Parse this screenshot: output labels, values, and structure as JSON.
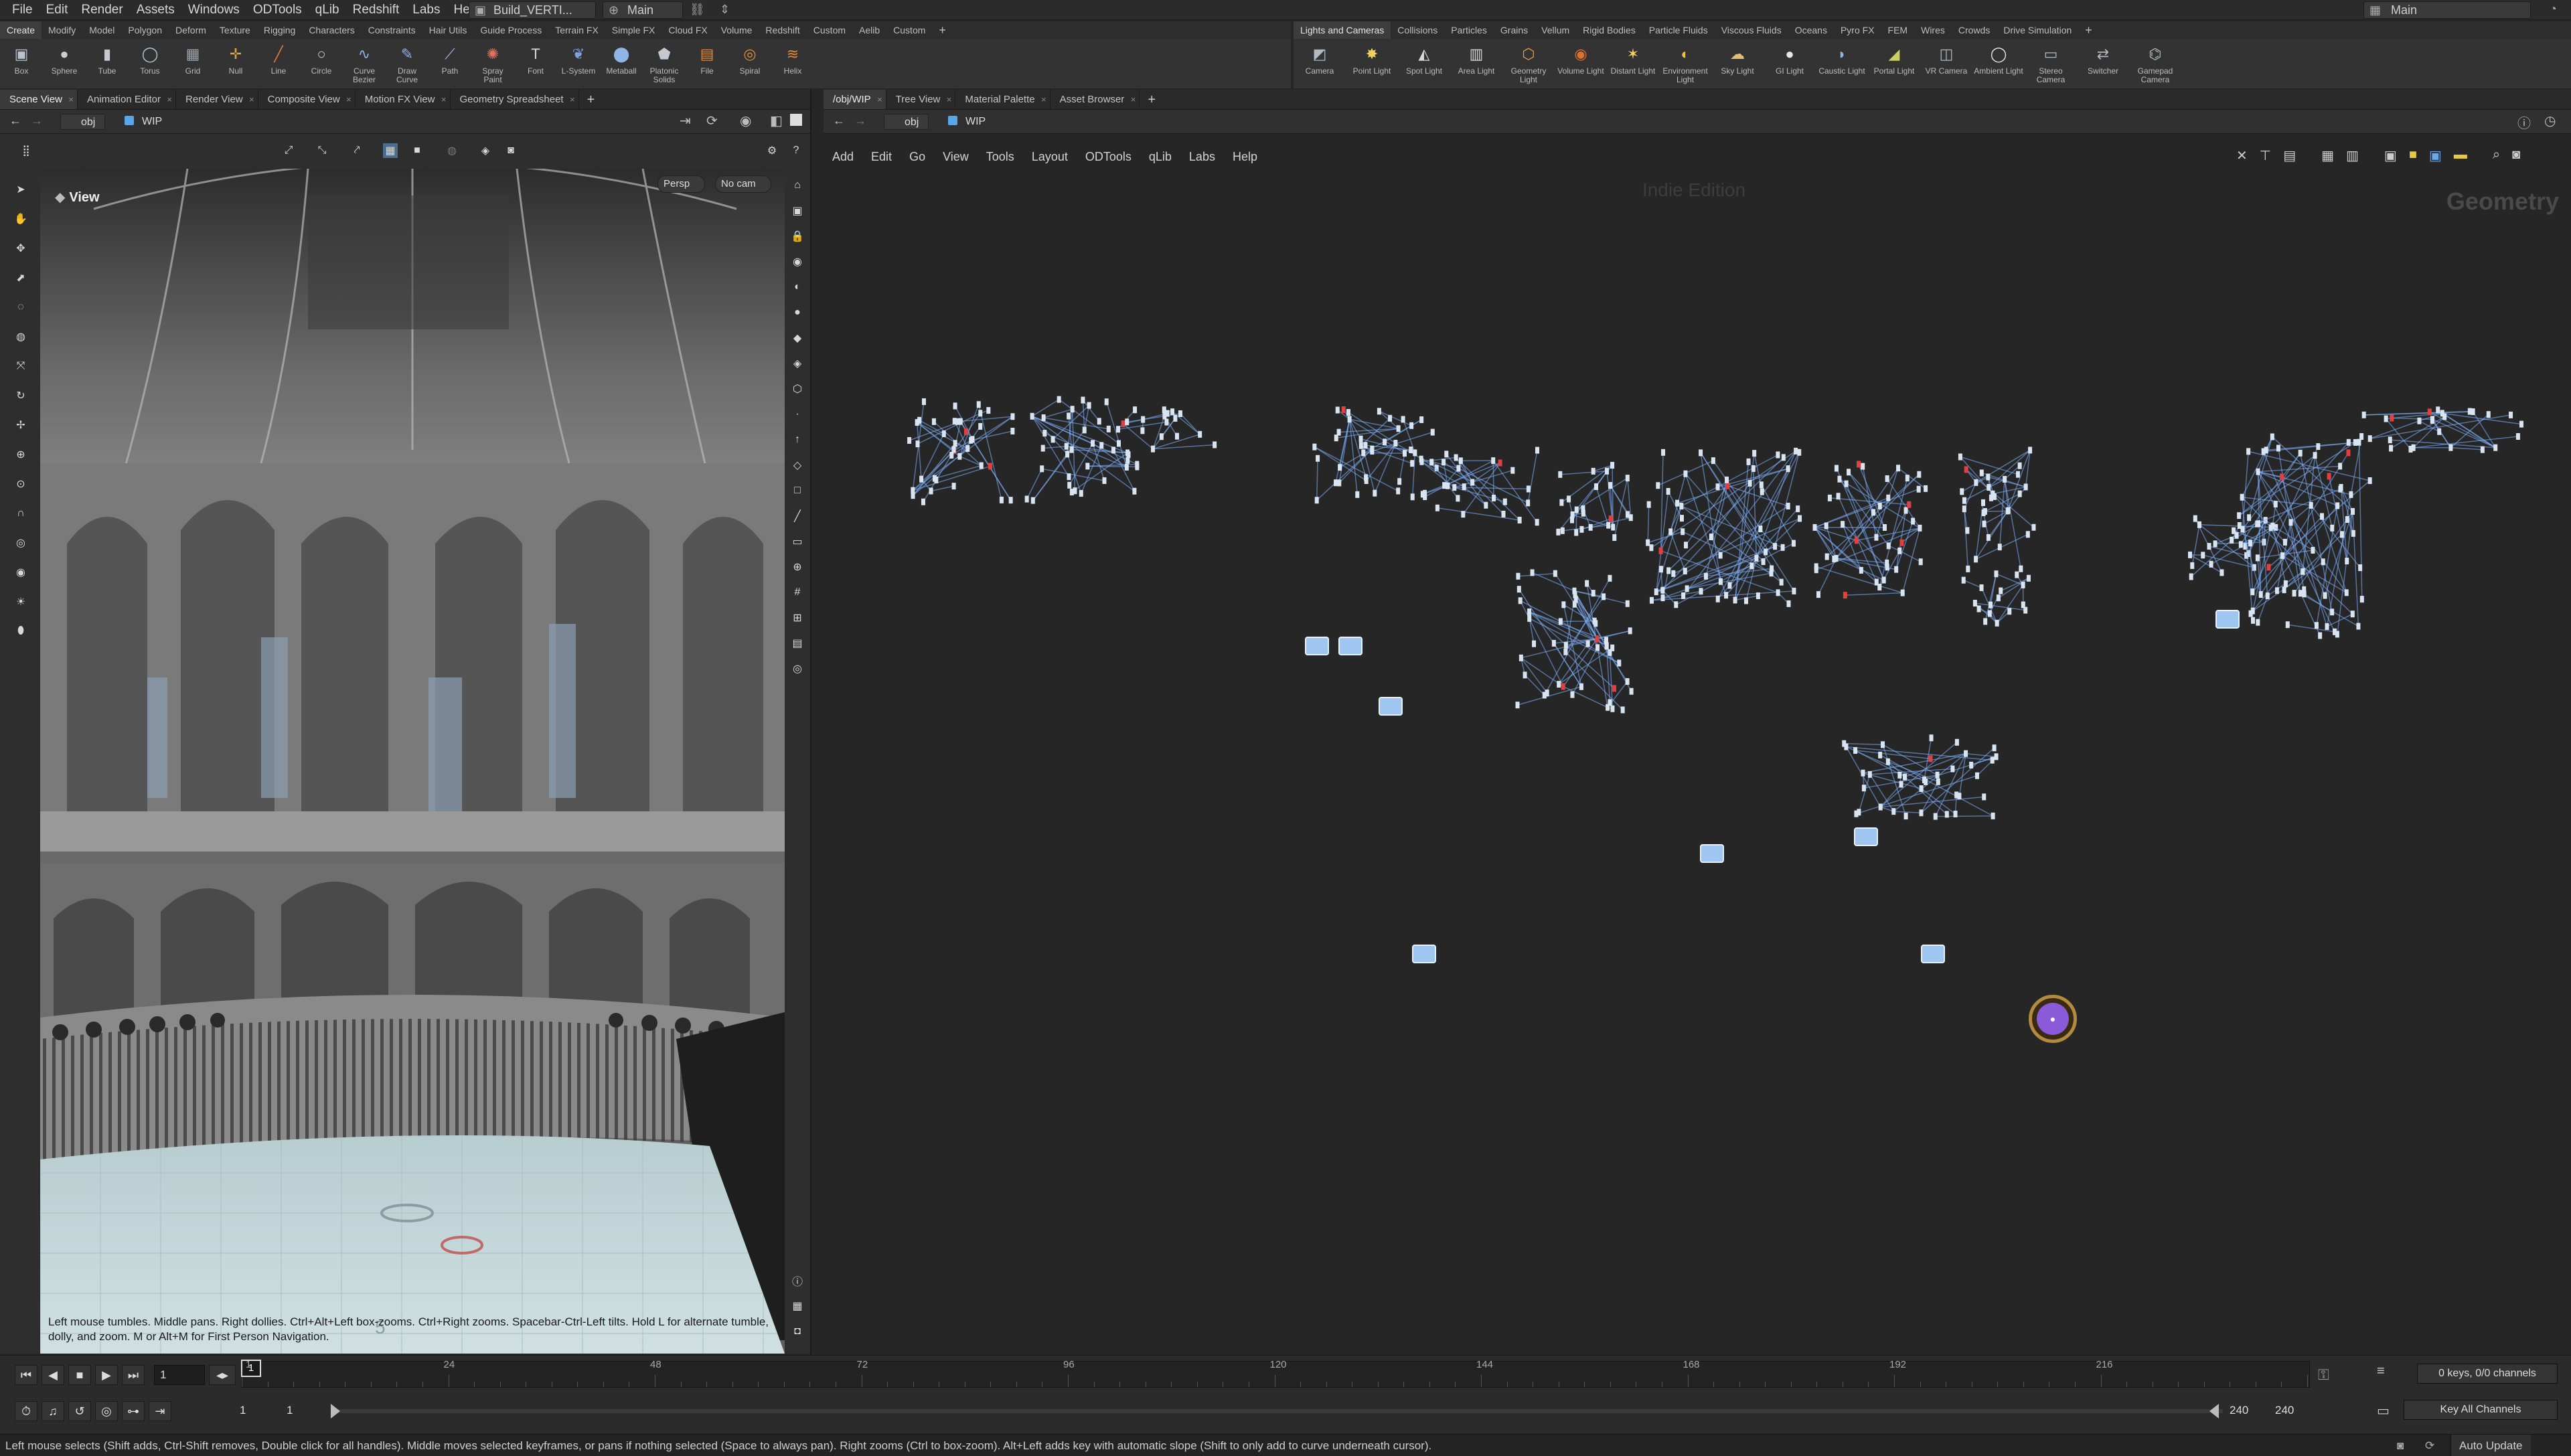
{
  "menubar": {
    "items": [
      "File",
      "Edit",
      "Render",
      "Assets",
      "Windows",
      "ODTools",
      "qLib",
      "Redshift",
      "Labs",
      "Help"
    ],
    "desktop_left": "Build_VERTI...",
    "desktop_mid": "Main",
    "desktop_right": "Main"
  },
  "shelf_left": {
    "tabs": [
      "Create",
      "Modify",
      "Model",
      "Polygon",
      "Deform",
      "Texture",
      "Rigging",
      "Characters",
      "Constraints",
      "Hair Utils",
      "Guide Process",
      "Terrain FX",
      "Simple FX",
      "Cloud FX",
      "Volume",
      "Redshift",
      "Custom",
      "Aelib",
      "Custom"
    ],
    "tools": [
      {
        "label": "Box",
        "icon": "box-icon",
        "glyph": "▣",
        "color": "#b9c3d0"
      },
      {
        "label": "Sphere",
        "icon": "sphere-icon",
        "glyph": "●",
        "color": "#c9ced6"
      },
      {
        "label": "Tube",
        "icon": "tube-icon",
        "glyph": "▮",
        "color": "#c3c9d1"
      },
      {
        "label": "Torus",
        "icon": "torus-icon",
        "glyph": "◯",
        "color": "#c3c9d1"
      },
      {
        "label": "Grid",
        "icon": "grid-icon",
        "glyph": "▦",
        "color": "#9aa3ad"
      },
      {
        "label": "Null",
        "icon": "null-icon",
        "glyph": "✛",
        "color": "#d7a64d"
      },
      {
        "label": "Line",
        "icon": "line-icon",
        "glyph": "╱",
        "color": "#d97a3a"
      },
      {
        "label": "Circle",
        "icon": "circle-icon",
        "glyph": "○",
        "color": "#c3c9d1"
      },
      {
        "label": "Curve Bezier",
        "icon": "curve-bezier-icon",
        "glyph": "∿",
        "color": "#8fb4e6"
      },
      {
        "label": "Draw Curve",
        "icon": "draw-curve-icon",
        "glyph": "✎",
        "color": "#8fb4e6"
      },
      {
        "label": "Path",
        "icon": "path-icon",
        "glyph": "⟋",
        "color": "#c9a0e8"
      },
      {
        "label": "Spray Paint",
        "icon": "spray-paint-icon",
        "glyph": "✺",
        "color": "#e07060"
      },
      {
        "label": "Font",
        "icon": "font-icon",
        "glyph": "T",
        "color": "#d8d8d8"
      },
      {
        "label": "L-System",
        "icon": "l-system-icon",
        "glyph": "❦",
        "color": "#7fa0e0"
      },
      {
        "label": "Metaball",
        "icon": "metaball-icon",
        "glyph": "⬤",
        "color": "#8fb4e6"
      },
      {
        "label": "Platonic Solids",
        "icon": "platonic-icon",
        "glyph": "⬟",
        "color": "#c3c9d1"
      },
      {
        "label": "File",
        "icon": "file-icon",
        "glyph": "▤",
        "color": "#e08a3a"
      },
      {
        "label": "Spiral",
        "icon": "spiral-icon",
        "glyph": "◎",
        "color": "#e08a3a"
      },
      {
        "label": "Helix",
        "icon": "helix-icon",
        "glyph": "≋",
        "color": "#e08a3a"
      }
    ]
  },
  "shelf_right": {
    "tabs": [
      "Lights and Cameras",
      "Collisions",
      "Particles",
      "Grains",
      "Vellum",
      "Rigid Bodies",
      "Particle Fluids",
      "Viscous Fluids",
      "Oceans",
      "Pyro FX",
      "FEM",
      "Wires",
      "Crowds",
      "Drive Simulation"
    ],
    "tools": [
      {
        "label": "Camera",
        "icon": "camera-icon",
        "glyph": "◩",
        "color": "#b0b8c2"
      },
      {
        "label": "Point Light",
        "icon": "point-light-icon",
        "glyph": "✸",
        "color": "#f0d060"
      },
      {
        "label": "Spot Light",
        "icon": "spot-light-icon",
        "glyph": "◭",
        "color": "#d8d8d8"
      },
      {
        "label": "Area Light",
        "icon": "area-light-icon",
        "glyph": "▥",
        "color": "#d8d8d8"
      },
      {
        "label": "Geometry Light",
        "icon": "geometry-light-icon",
        "glyph": "⬡",
        "color": "#e0a050"
      },
      {
        "label": "Volume Light",
        "icon": "volume-light-icon",
        "glyph": "◉",
        "color": "#e07030"
      },
      {
        "label": "Distant Light",
        "icon": "distant-light-icon",
        "glyph": "✶",
        "color": "#f0d060"
      },
      {
        "label": "Environment Light",
        "icon": "environment-light-icon",
        "glyph": "◐",
        "color": "#f0c040"
      },
      {
        "label": "Sky Light",
        "icon": "sky-light-icon",
        "glyph": "☁",
        "color": "#e0c070"
      },
      {
        "label": "GI Light",
        "icon": "gi-light-icon",
        "glyph": "●",
        "color": "#e8e8e8"
      },
      {
        "label": "Caustic Light",
        "icon": "caustic-light-icon",
        "glyph": "◗",
        "color": "#8fb4e6"
      },
      {
        "label": "Portal Light",
        "icon": "portal-light-icon",
        "glyph": "◢",
        "color": "#c8d060"
      },
      {
        "label": "VR Camera",
        "icon": "vr-camera-icon",
        "glyph": "◫",
        "color": "#b0b8c2"
      },
      {
        "label": "Ambient Light",
        "icon": "ambient-light-icon",
        "glyph": "◯",
        "color": "#e8e8e8"
      },
      {
        "label": "Stereo Camera",
        "icon": "stereo-camera-icon",
        "glyph": "▭",
        "color": "#b0b8c2"
      },
      {
        "label": "Switcher",
        "icon": "switcher-icon",
        "glyph": "⇄",
        "color": "#b0b8c2"
      },
      {
        "label": "Gamepad Camera",
        "icon": "gamepad-camera-icon",
        "glyph": "⌬",
        "color": "#b0b8c2"
      }
    ]
  },
  "left_pane": {
    "tabs": [
      "Scene View",
      "Animation Editor",
      "Render View",
      "Composite View",
      "Motion FX View",
      "Geometry Spreadsheet"
    ],
    "path": [
      "obj",
      "WIP"
    ],
    "viewport_label": "View",
    "persp": "Persp",
    "nocam": "No cam",
    "hint": "Left mouse tumbles. Middle pans. Right dollies. Ctrl+Alt+Left box-zooms. Ctrl+Right zooms. Spacebar-Ctrl-Left tilts. Hold L for alternate tumble, dolly, and zoom.   M or Alt+M for First Person Navigation."
  },
  "right_pane": {
    "tabs": [
      "/obj/WIP",
      "Tree View",
      "Material Palette",
      "Asset Browser"
    ],
    "path": [
      "obj",
      "WIP"
    ],
    "menu": [
      "Add",
      "Edit",
      "Go",
      "View",
      "Tools",
      "Layout",
      "ODTools",
      "qLib",
      "Labs",
      "Help"
    ],
    "watermark": "Indie Edition",
    "context": "Geometry"
  },
  "timeline": {
    "frame": "1",
    "ticks": [
      "1",
      "24",
      "48",
      "72",
      "96",
      "120",
      "144",
      "168",
      "192",
      "216"
    ],
    "start": "1",
    "start2": "1",
    "end": "240",
    "end2": "240",
    "keys_info": "0 keys, 0/0 channels",
    "key_all": "Key All Channels",
    "auto_update": "Auto Update"
  },
  "status": "Left mouse selects (Shift adds, Ctrl-Shift removes, Double click for all handles). Middle moves selected keyframes, or pans if nothing selected (Space to always pan). Right zooms (Ctrl to box-zoom). Alt+Left adds key with automatic slope (Shift to only add to curve underneath cursor).",
  "colors": {
    "accent": "#7fb2ff",
    "node_circle": "#8a5ad8",
    "network_bg": "#262626",
    "viewport_floor": "#bfd4d6"
  }
}
